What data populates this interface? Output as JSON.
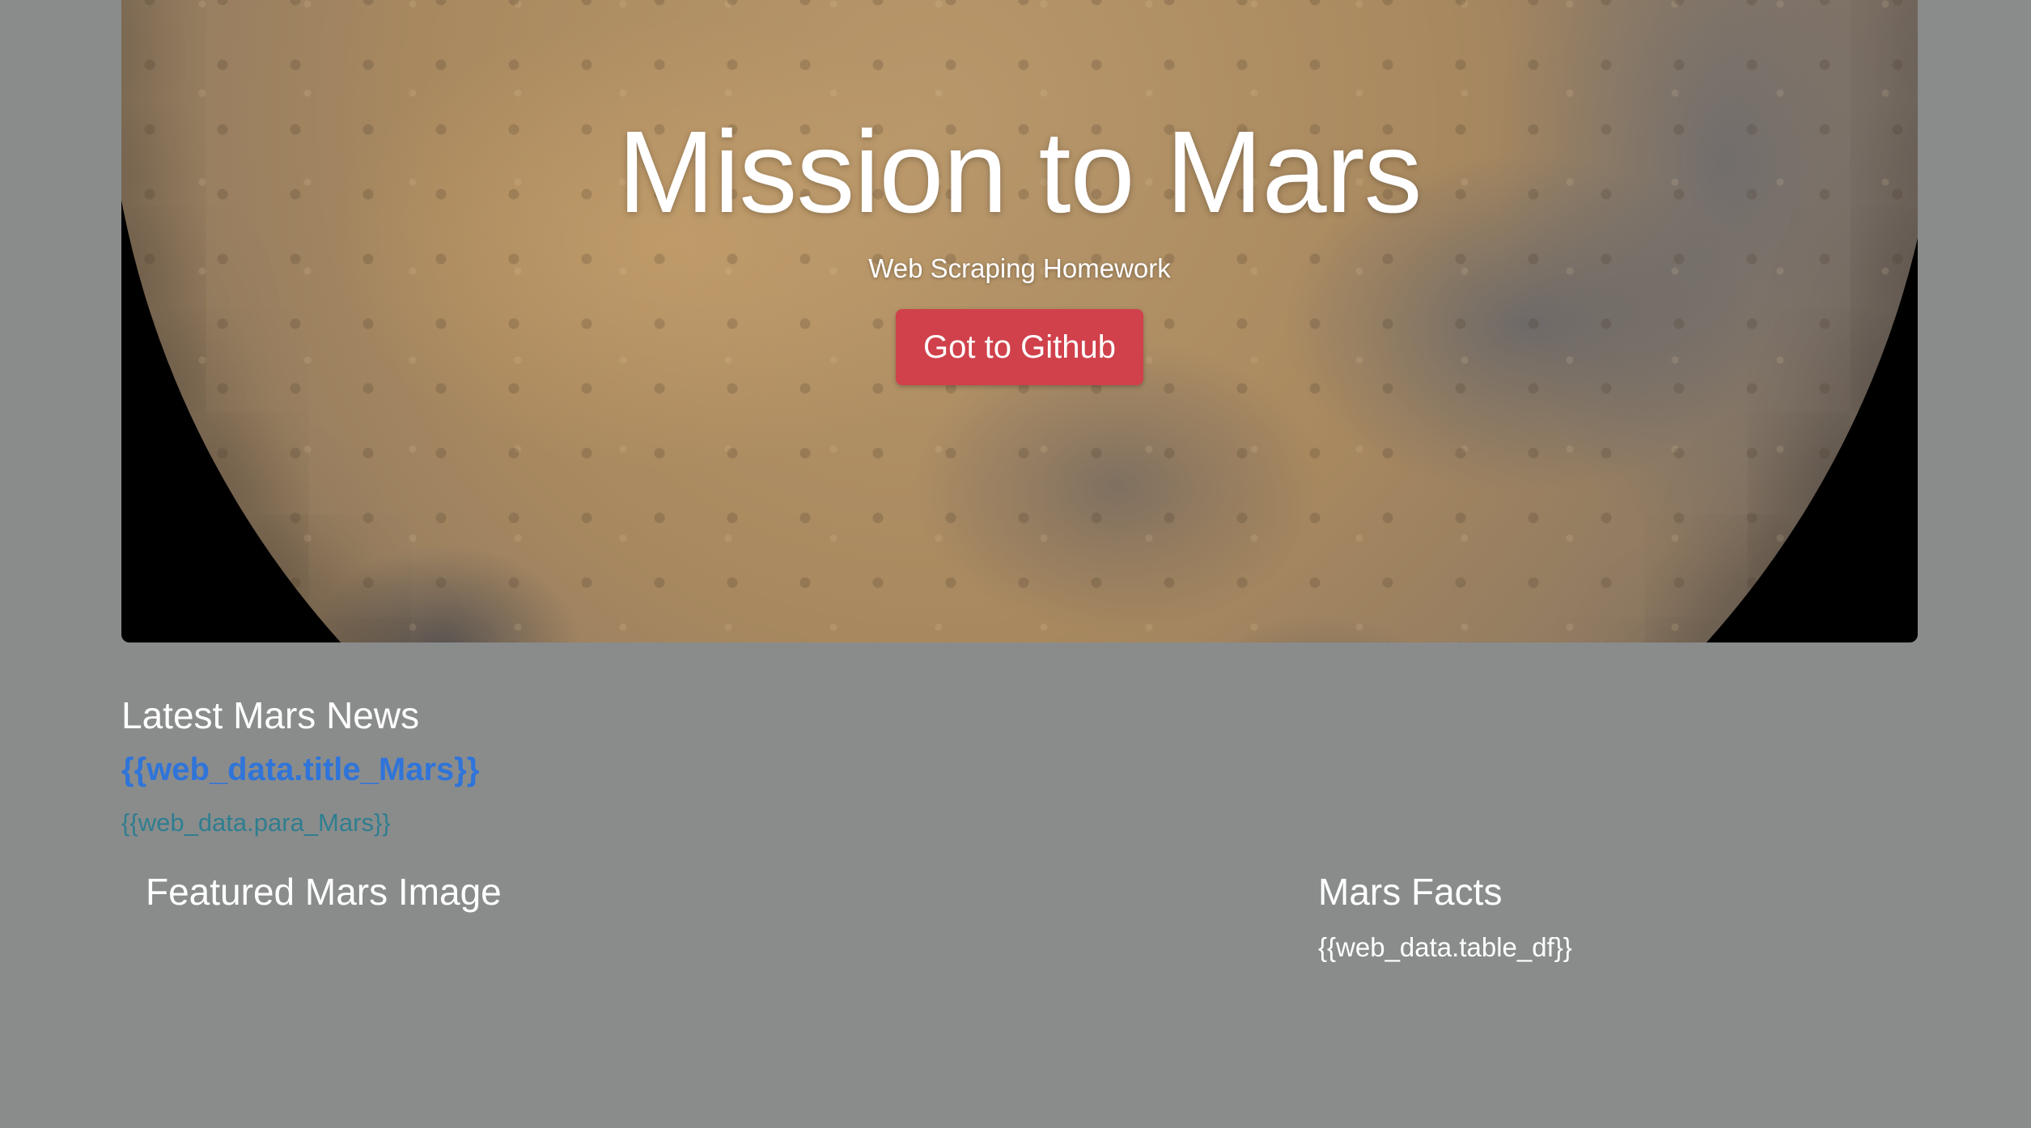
{
  "hero": {
    "title": "Mission to Mars",
    "subtitle": "Web Scraping Homework",
    "button_label": "Got to Github",
    "button_color": "#d0414b"
  },
  "news": {
    "heading": "Latest Mars News",
    "title": "{{web_data.title_Mars}}",
    "paragraph": "{{web_data.para_Mars}}",
    "title_color": "#2f74d9",
    "paragraph_color": "#2f7e8f"
  },
  "featured": {
    "heading": "Featured Mars Image"
  },
  "facts": {
    "heading": "Mars Facts",
    "table_placeholder": "{{web_data.table_df}}"
  },
  "colors": {
    "background": "#8a8c8c",
    "hero_background": "#000000"
  }
}
